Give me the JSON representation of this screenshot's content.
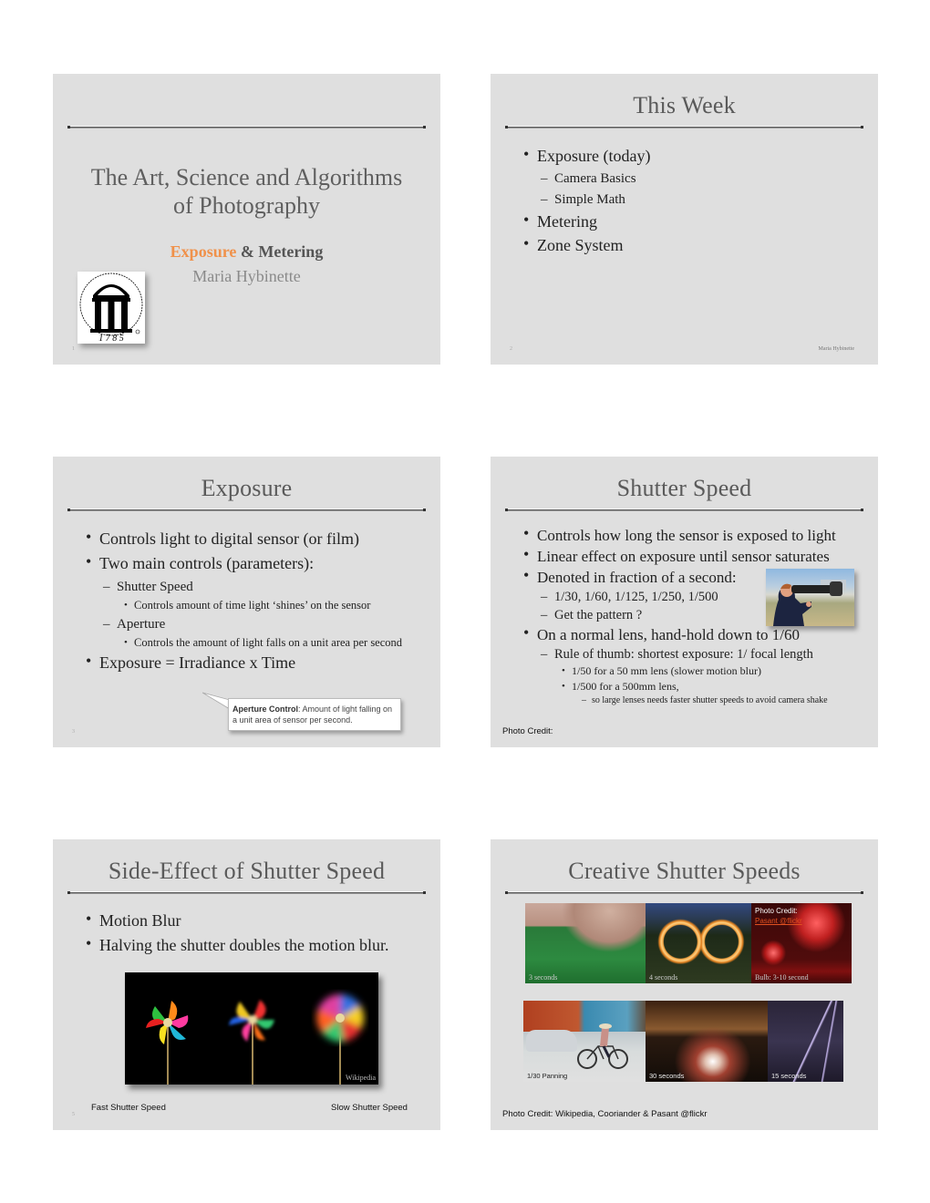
{
  "slides": [
    {
      "number": "1",
      "title_lines": [
        "The Art, Science and Algorithms",
        "of Photography"
      ],
      "subtitle_accent": "Exposure",
      "subtitle_rest": " & Metering",
      "author": "Maria Hybinette",
      "logo": {
        "icon": "university-arch-logo",
        "year": "1 7 8 5"
      },
      "accent_color": "#f0914a"
    },
    {
      "number": "2",
      "title": "This Week",
      "footer": "Maria Hybinette",
      "items": [
        {
          "level": 1,
          "text": "Exposure (today)"
        },
        {
          "level": 2,
          "text": "Camera Basics"
        },
        {
          "level": 2,
          "text": "Simple Math"
        },
        {
          "level": 1,
          "text": "Metering"
        },
        {
          "level": 1,
          "text": "Zone System"
        }
      ]
    },
    {
      "number": "3",
      "title": "Exposure",
      "items": [
        {
          "level": 1,
          "text": "Controls light to digital sensor (or film)"
        },
        {
          "level": 1,
          "text": "Two main controls (parameters):"
        },
        {
          "level": 2,
          "text": "Shutter Speed"
        },
        {
          "level": 3,
          "text": "Controls amount of time light ‘shines’ on the sensor"
        },
        {
          "level": 2,
          "text": "Aperture"
        },
        {
          "level": 3,
          "text": "Controls the amount of light falls on a unit area per second"
        },
        {
          "level": 1,
          "text": "Exposure = Irradiance x Time"
        }
      ],
      "callout": {
        "bold": "Aperture Control",
        "text": ":  Amount of light falling on a unit area of sensor per second."
      }
    },
    {
      "number": "4",
      "title": "Shutter Speed",
      "items": [
        {
          "level": 1,
          "text": "Controls how long the sensor is exposed to light"
        },
        {
          "level": 1,
          "text": "Linear effect on exposure until sensor saturates"
        },
        {
          "level": 1,
          "text": "Denoted in fraction of  a second:"
        },
        {
          "level": 2,
          "text": "1/30, 1/60, 1/125, 1/250, 1/500"
        },
        {
          "level": 2,
          "text": "Get the pattern ?"
        },
        {
          "level": 1,
          "text": "On a normal lens, hand-hold down to 1/60"
        },
        {
          "level": 2,
          "text": "Rule of thumb: shortest exposure: 1/ focal length"
        },
        {
          "level": 3,
          "text": "1/50 for a 50 mm lens (slower motion blur)"
        },
        {
          "level": 3,
          "text": "1/500 for a 500mm lens,"
        },
        {
          "level": 4,
          "text": "so large lenses needs faster shutter speeds to avoid camera shake"
        }
      ],
      "photo_credit": "Photo Credit:",
      "photo": "photographer-with-telephoto-lens"
    },
    {
      "number": "5",
      "title": "Side-Effect of Shutter Speed",
      "items": [
        {
          "level": 1,
          "text": "Motion Blur"
        },
        {
          "level": 1,
          "text": "Halving the shutter doubles the motion blur."
        }
      ],
      "image_watermark": "Wikipedia",
      "left_label": "Fast Shutter Speed",
      "right_label": "Slow Shutter Speed"
    },
    {
      "number": "6",
      "title": "Creative Shutter Speeds",
      "photos": [
        {
          "subject": "billiards",
          "caption": "3 seconds"
        },
        {
          "subject": "sparkler-light-painting",
          "caption": "4 seconds"
        },
        {
          "subject": "fireworks",
          "caption": "Bulb: 3-10 second",
          "credit_label": "Photo Credit:",
          "credit_link": "Pasant @flickr"
        },
        {
          "subject": "cyclist-panning",
          "caption": "1/30 Panning"
        },
        {
          "subject": "highway-light-trails",
          "caption": "30 seconds"
        },
        {
          "subject": "lightning",
          "caption": "15 seconds"
        }
      ],
      "photo_credit": "Photo Credit: Wikipedia, Cooriander & Pasant @flickr"
    }
  ]
}
